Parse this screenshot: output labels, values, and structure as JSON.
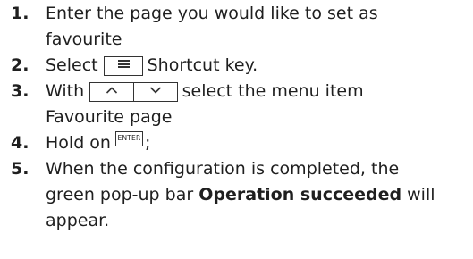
{
  "steps": [
    {
      "number": "1.",
      "line1": "Enter the page you would like to set as",
      "line2": "favourite"
    },
    {
      "number": "2.",
      "before_key": "Select",
      "after_key": "Shortcut key.",
      "key_icon": "menu-icon"
    },
    {
      "number": "3.",
      "before_keys": "With",
      "after_keys": "select the menu item",
      "line2": "Favourite page",
      "key_icons": [
        "arrow-up-icon",
        "arrow-down-icon"
      ]
    },
    {
      "number": "4.",
      "before_key": "Hold on",
      "key_label": "ENTER",
      "after_key": ";"
    },
    {
      "number": "5.",
      "line1": "When the configuration is completed, the",
      "line2_before": "green pop-up bar",
      "line2_bold": "Operation succeeded",
      "line2_after": "will",
      "line3": "appear."
    }
  ]
}
